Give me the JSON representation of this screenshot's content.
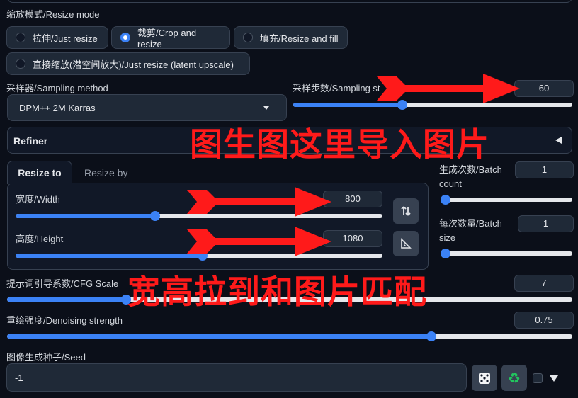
{
  "resize_mode": {
    "label": "缩放模式/Resize mode",
    "options": [
      {
        "label": "拉伸/Just resize",
        "selected": false
      },
      {
        "label": "裁剪/Crop and resize",
        "selected": true
      },
      {
        "label": "填充/Resize and fill",
        "selected": false
      },
      {
        "label": "直接缩放(潜空间放大)/Just resize (latent upscale)",
        "selected": false
      }
    ]
  },
  "sampler": {
    "label": "采样器/Sampling method",
    "value": "DPM++ 2M Karras"
  },
  "steps": {
    "label": "采样步数/Sampling steps",
    "label_visible": "采样步数/Sampling st",
    "value": "60",
    "fraction": 0.39
  },
  "refiner": {
    "label": "Refiner"
  },
  "size_tabs": {
    "active": "Resize to",
    "inactive": "Resize by"
  },
  "width": {
    "label": "宽度/Width",
    "value": "800",
    "fraction": 0.38
  },
  "height": {
    "label": "高度/Height",
    "value": "1080",
    "fraction": 0.51
  },
  "batch_count": {
    "label": "生成次数/Batch count",
    "value": "1",
    "fraction": 0.0
  },
  "batch_size": {
    "label": "每次数量/Batch size",
    "value": "1",
    "fraction": 0.0
  },
  "cfg": {
    "label": "提示词引导系数/CFG Scale",
    "value": "7",
    "fraction": 0.21
  },
  "denoise": {
    "label": "重绘强度/Denoising strength",
    "value": "0.75",
    "fraction": 0.75
  },
  "seed": {
    "label": "图像生成种子/Seed",
    "value": "-1"
  },
  "annotations": {
    "import_image": "图生图这里导入图片",
    "match_size": "宽高拉到和图片匹配"
  },
  "colors": {
    "accent": "#3b82f6",
    "annotation": "#ff1a1a",
    "background": "#0b0f19"
  }
}
